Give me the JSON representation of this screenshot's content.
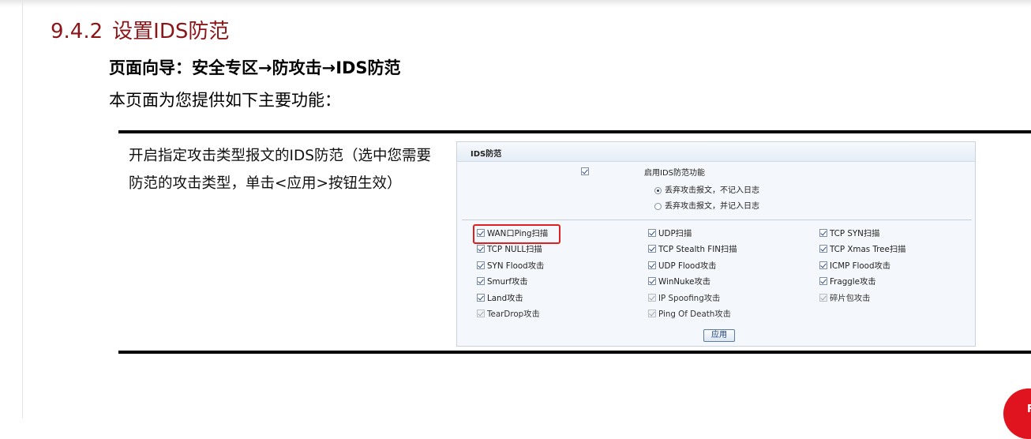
{
  "section": {
    "number": "9.4.2",
    "title": "设置IDS防范"
  },
  "nav_guide": "页面向导：安全专区→防攻击→IDS防范",
  "intro": "本页面为您提供如下主要功能：",
  "description": "开启指定攻击类型报文的IDS防范（选中您需要防范的攻击类型，单击<应用>按钮生效）",
  "panel": {
    "title": "IDS防范",
    "enable_label": "启用IDS防范功能",
    "enable_checked": true,
    "options": [
      {
        "label": "丢弃攻击报文，不记入日志",
        "selected": true
      },
      {
        "label": "丢弃攻击报文，并记入日志",
        "selected": false
      }
    ],
    "attacks": [
      [
        {
          "label": "WAN口Ping扫描",
          "checked": true,
          "disabled": false
        },
        {
          "label": "TCP NULL扫描",
          "checked": true,
          "disabled": false
        },
        {
          "label": "SYN Flood攻击",
          "checked": true,
          "disabled": false
        },
        {
          "label": "Smurf攻击",
          "checked": true,
          "disabled": false
        },
        {
          "label": "Land攻击",
          "checked": true,
          "disabled": false
        },
        {
          "label": "TearDrop攻击",
          "checked": true,
          "disabled": true
        }
      ],
      [
        {
          "label": "UDP扫描",
          "checked": true,
          "disabled": false
        },
        {
          "label": "TCP Stealth FIN扫描",
          "checked": true,
          "disabled": false
        },
        {
          "label": "UDP Flood攻击",
          "checked": true,
          "disabled": false
        },
        {
          "label": "WinNuke攻击",
          "checked": true,
          "disabled": false
        },
        {
          "label": "IP Spoofing攻击",
          "checked": true,
          "disabled": true
        },
        {
          "label": "Ping Of Death攻击",
          "checked": true,
          "disabled": true
        }
      ],
      [
        {
          "label": "TCP SYN扫描",
          "checked": true,
          "disabled": false
        },
        {
          "label": "TCP Xmas Tree扫描",
          "checked": true,
          "disabled": false
        },
        {
          "label": "ICMP Flood攻击",
          "checked": true,
          "disabled": false
        },
        {
          "label": "Fraggle攻击",
          "checked": true,
          "disabled": false
        },
        {
          "label": "碎片包攻击",
          "checked": true,
          "disabled": true
        }
      ]
    ],
    "apply_label": "应用",
    "highlight_color": "#e02020"
  },
  "colors": {
    "title": "#8b1518",
    "badge": "#e0141e"
  },
  "corner_badge": {
    "text": "F"
  }
}
